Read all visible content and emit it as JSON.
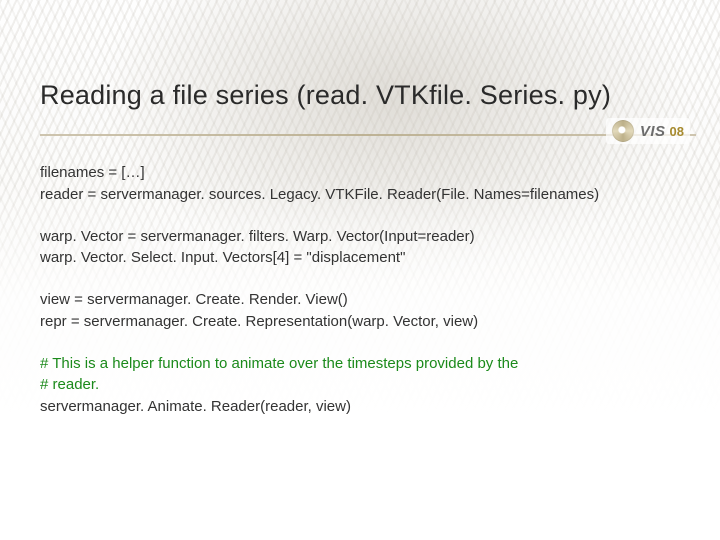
{
  "title": "Reading a file series (read. VTKfile. Series. py)",
  "brand": {
    "name": "VIS",
    "year": "08"
  },
  "code": {
    "b1": {
      "l1": "filenames = […]",
      "l2": "reader = servermanager. sources. Legacy. VTKFile. Reader(File. Names=filenames)"
    },
    "b2": {
      "l1": "warp. Vector = servermanager. filters. Warp. Vector(Input=reader)",
      "l2": "warp. Vector. Select. Input. Vectors[4] = \"displacement\""
    },
    "b3": {
      "l1": "view = servermanager. Create. Render. View()",
      "l2": "repr = servermanager. Create. Representation(warp. Vector, view)"
    },
    "b4": {
      "c1": "# This is a helper function to animate over the timesteps provided by the",
      "c2": "# reader.",
      "l1": "servermanager. Animate. Reader(reader, view)"
    }
  }
}
